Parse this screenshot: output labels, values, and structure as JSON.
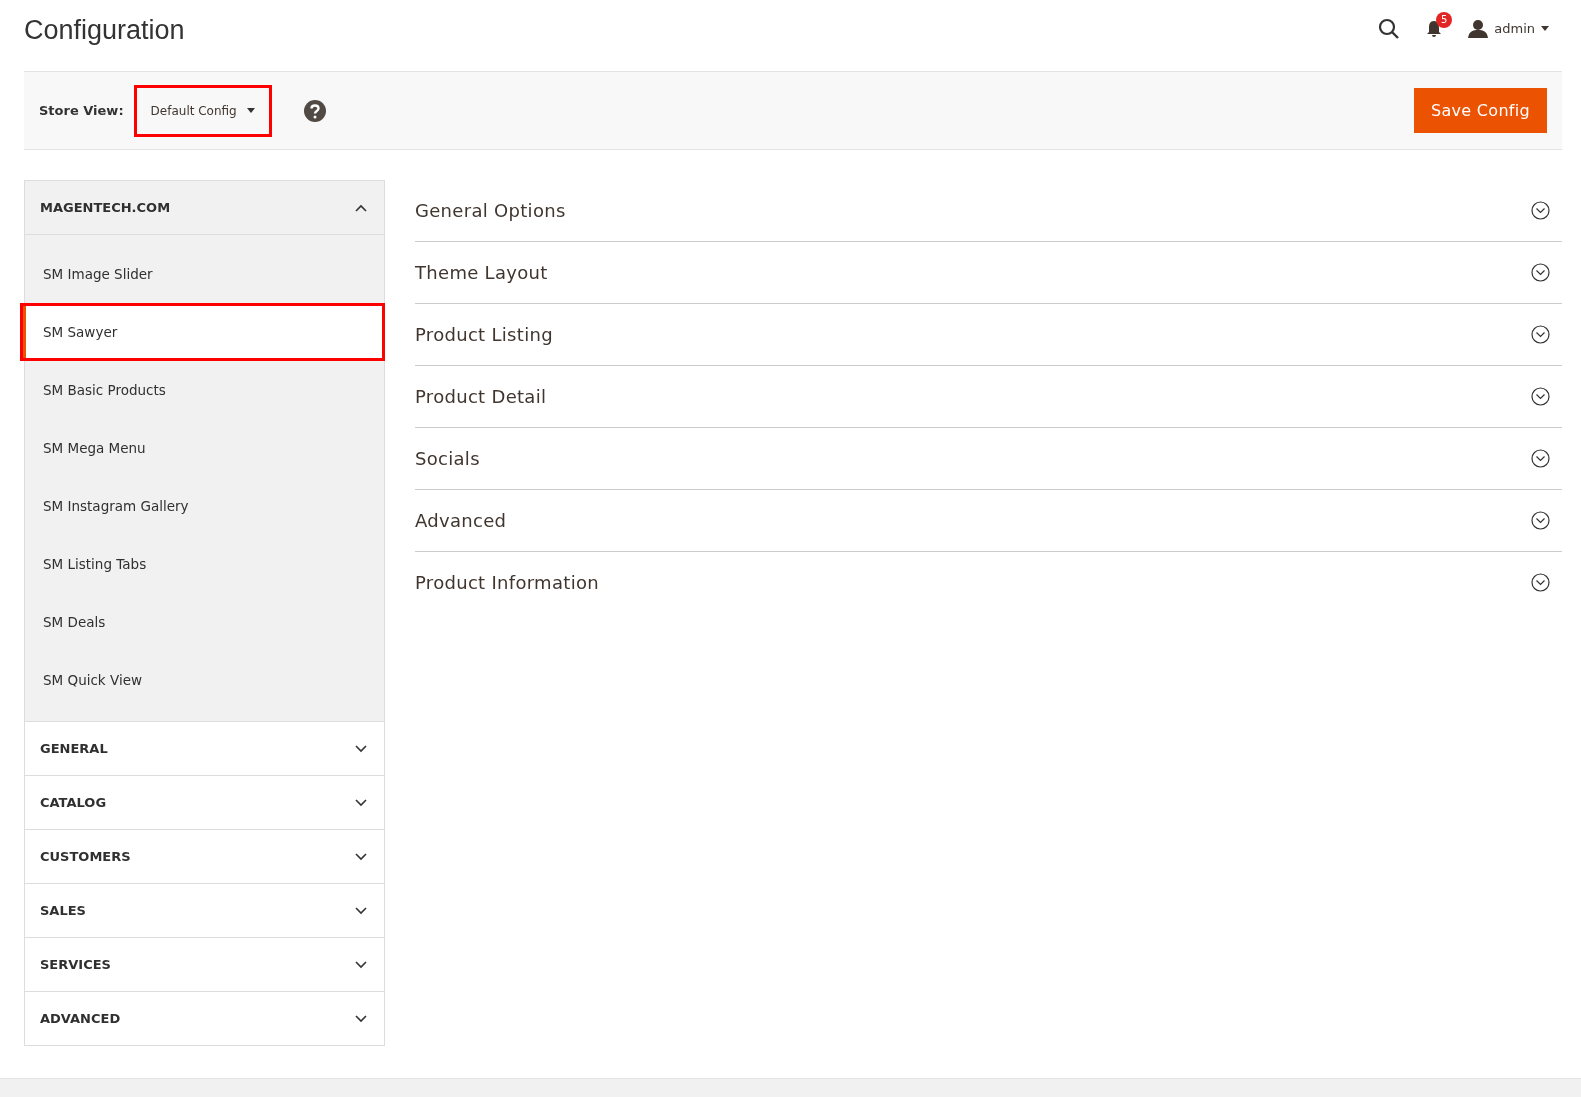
{
  "page": {
    "title": "Configuration"
  },
  "header": {
    "notifications_count": "5",
    "user": "admin"
  },
  "store_view": {
    "label": "Store View:",
    "value": "Default Config",
    "annotated": true
  },
  "save_button": "Save Config",
  "sidebar": [
    {
      "title": "MAGENTECH.COM",
      "expanded": true,
      "children": [
        {
          "label": "SM Image Slider",
          "selected": false,
          "annotated": false
        },
        {
          "label": "SM Sawyer",
          "selected": true,
          "annotated": true
        },
        {
          "label": "SM Basic Products",
          "selected": false,
          "annotated": false
        },
        {
          "label": "SM Mega Menu",
          "selected": false,
          "annotated": false
        },
        {
          "label": "SM Instagram Gallery",
          "selected": false,
          "annotated": false
        },
        {
          "label": "SM Listing Tabs",
          "selected": false,
          "annotated": false
        },
        {
          "label": "SM Deals",
          "selected": false,
          "annotated": false
        },
        {
          "label": "SM Quick View",
          "selected": false,
          "annotated": false
        }
      ]
    },
    {
      "title": "GENERAL",
      "expanded": false
    },
    {
      "title": "CATALOG",
      "expanded": false
    },
    {
      "title": "CUSTOMERS",
      "expanded": false
    },
    {
      "title": "SALES",
      "expanded": false
    },
    {
      "title": "SERVICES",
      "expanded": false
    },
    {
      "title": "ADVANCED",
      "expanded": false
    }
  ],
  "sections": [
    {
      "title": "General Options",
      "expanded": false
    },
    {
      "title": "Theme Layout",
      "expanded": false
    },
    {
      "title": "Product Listing",
      "expanded": false
    },
    {
      "title": "Product Detail",
      "expanded": false
    },
    {
      "title": "Socials",
      "expanded": false
    },
    {
      "title": "Advanced",
      "expanded": false
    },
    {
      "title": "Product Information",
      "expanded": false
    }
  ]
}
